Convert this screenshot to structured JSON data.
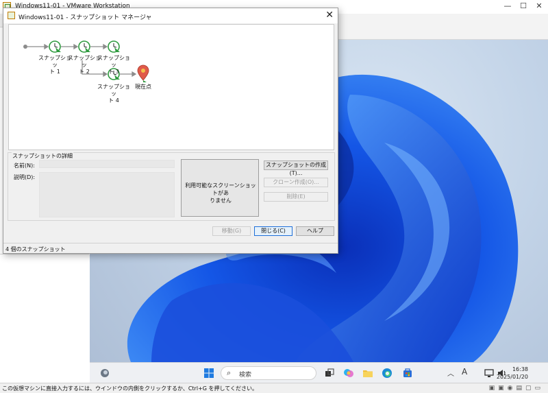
{
  "vmware": {
    "title": "Windows11-01 - VMware Workstation",
    "window_buttons": [
      "—",
      "☐",
      "✕"
    ]
  },
  "dialog": {
    "title": "Windows11-01 - スナップショット マネージャ",
    "close_glyph": "✕",
    "tree": {
      "nodes": [
        {
          "id": "snap1",
          "label_lines": [
            "スナップショッ",
            "ト 1"
          ]
        },
        {
          "id": "snap2",
          "label_lines": [
            "スナップショッ",
            "ト 2"
          ]
        },
        {
          "id": "snap3",
          "label_lines": [
            "スナップショッ",
            "ト 3"
          ]
        },
        {
          "id": "snap4",
          "label_lines": [
            "スナップショッ",
            "ト 4"
          ]
        },
        {
          "id": "current",
          "label_lines": [
            "現在点"
          ]
        }
      ]
    },
    "details": {
      "group_label": "スナップショットの詳細",
      "name_label": "名前(N):",
      "desc_label": "説明(D):",
      "no_screenshot_lines": [
        "利用可能なスクリーンショットがあ",
        "りません"
      ]
    },
    "buttons": {
      "take": "スナップショットの作成(T)...",
      "clone": "クローン作成(O)...",
      "delete": "削除(E)",
      "goto": "移動(G)",
      "close": "閉じる(C)",
      "help": "ヘルプ"
    },
    "status": "4 個のスナップショット"
  },
  "guest": {
    "search_placeholder": "検索",
    "clock_time": "16:38",
    "clock_date": "2025/01/20",
    "ime_indicator": "A"
  },
  "statusbar": {
    "message": "この仮想マシンに直接入力するには、ウインドウの内側をクリックするか、Ctrl+G を押してください。"
  },
  "colors": {
    "accent": "#1e6fd9",
    "snapshot_green": "#2e9a3e",
    "current_pin": "#e05a4a"
  }
}
